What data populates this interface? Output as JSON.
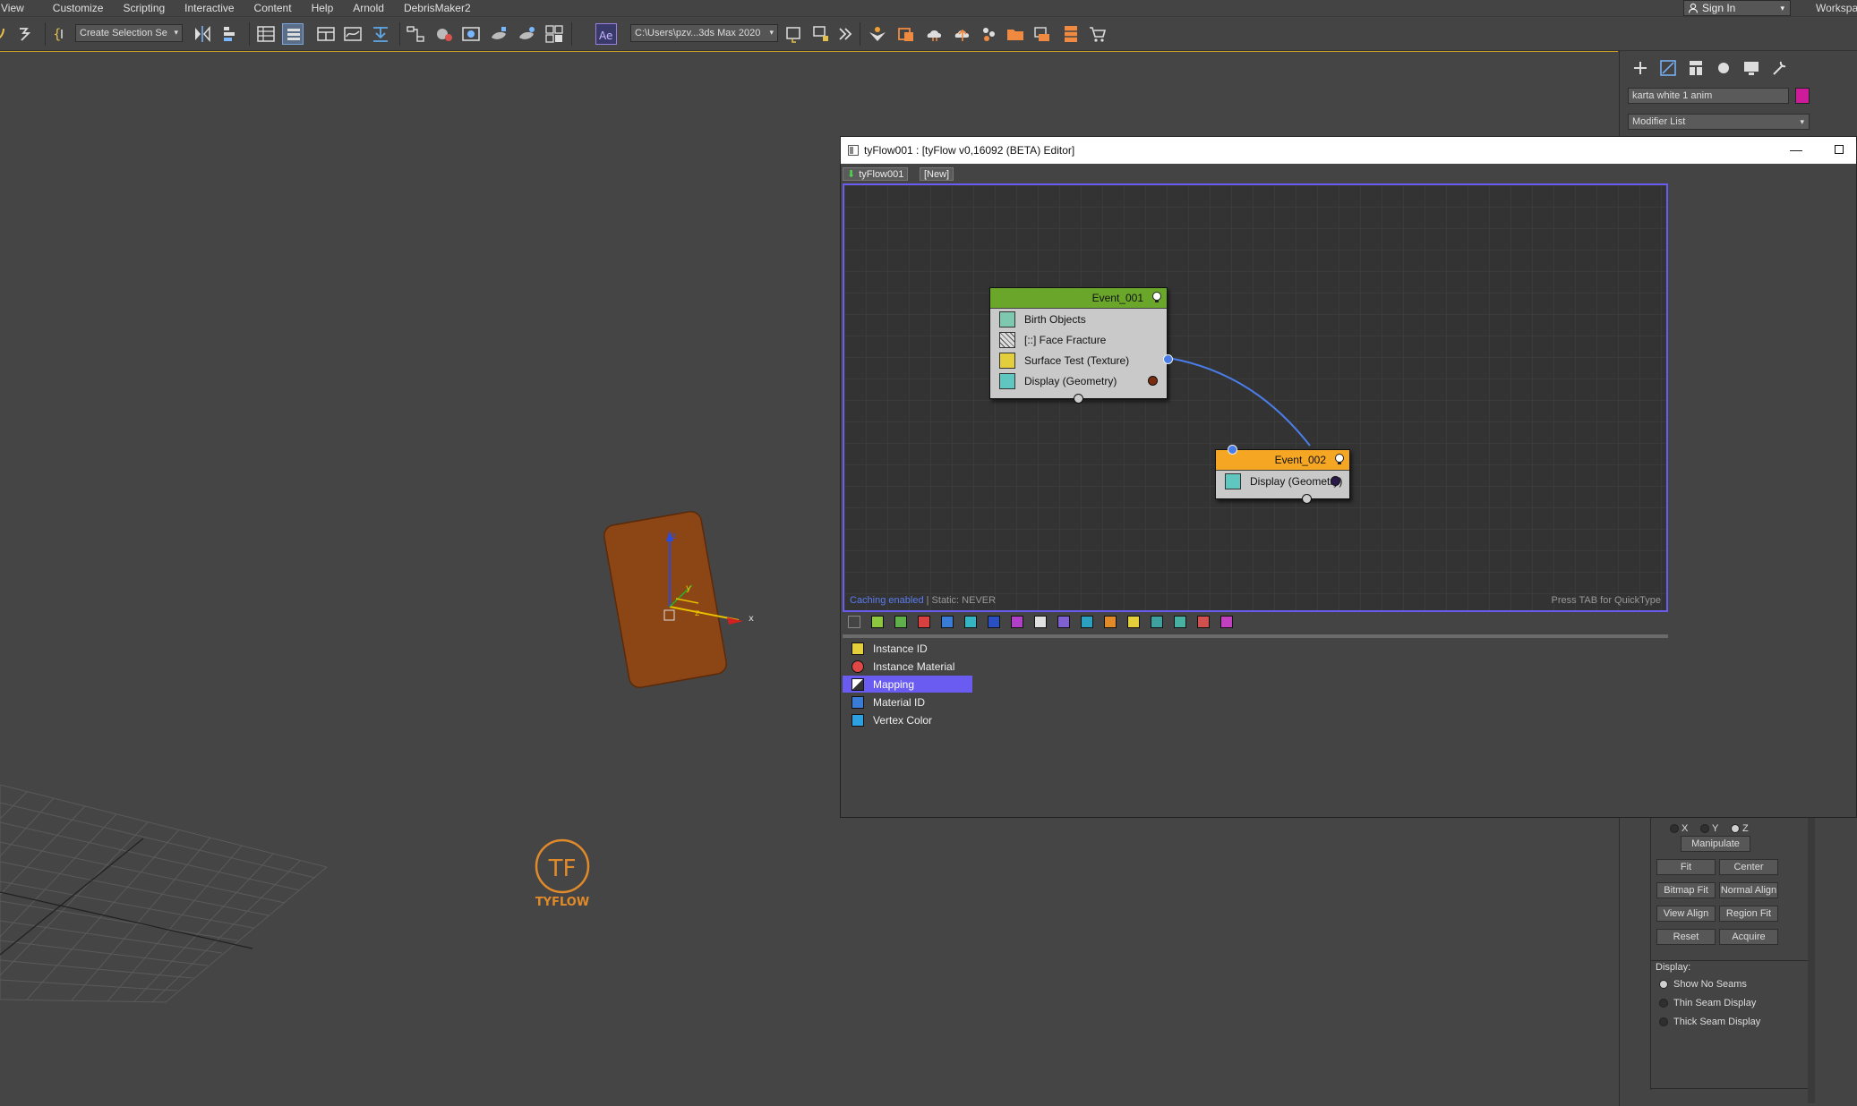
{
  "menu": {
    "items": [
      "l View",
      "Customize",
      "Scripting",
      "Interactive",
      "Content",
      "Help",
      "Arnold",
      "DebrisMaker2"
    ]
  },
  "signin": {
    "label": "Sign In"
  },
  "workspace": {
    "label": "Workspac"
  },
  "toolbar": {
    "selection_set": "Create Selection Se",
    "project_path": "C:\\Users\\pzv...3ds Max 2020"
  },
  "command_panel": {
    "object_name": "karta white 1 anim",
    "object_color": "#cc1c9a",
    "modifier_list": "Modifier List",
    "axis_labels": [
      "X",
      "Y",
      "Z"
    ],
    "manipulate": "Manipulate",
    "buttons": [
      "Fit",
      "Center",
      "Bitmap Fit",
      "Normal Align",
      "View Align",
      "Region Fit",
      "Reset",
      "Acquire"
    ],
    "display_label": "Display:",
    "display_options": [
      "Show No Seams",
      "Thin Seam Display",
      "Thick Seam Display"
    ]
  },
  "editor": {
    "title": "tyFlow001 : [tyFlow v0,16092 (BETA) Editor]",
    "tabs": [
      "tyFlow001",
      "[New]"
    ],
    "status_caching": "Caching enabled",
    "status_static": " | Static: NEVER",
    "quicktype_hint": "Press TAB for QuickType",
    "event1": {
      "name": "Event_001",
      "color": "#69a629",
      "operators": [
        "Birth Objects",
        "[::] Face Fracture",
        "Surface Test (Texture)",
        "Display (Geometry)"
      ]
    },
    "event2": {
      "name": "Event_002",
      "color": "#f5a623",
      "operators": [
        "Display (Geometry)"
      ]
    },
    "operator_list": [
      "Instance ID",
      "Instance Material",
      "Mapping",
      "Material ID",
      "Vertex Color"
    ],
    "selected_operator": "Mapping"
  },
  "viewport": {
    "gizmo_labels": {
      "x": "x",
      "y": "y",
      "z": "z"
    },
    "logo_text": "TYFLOW",
    "logo_mark": "TF"
  }
}
